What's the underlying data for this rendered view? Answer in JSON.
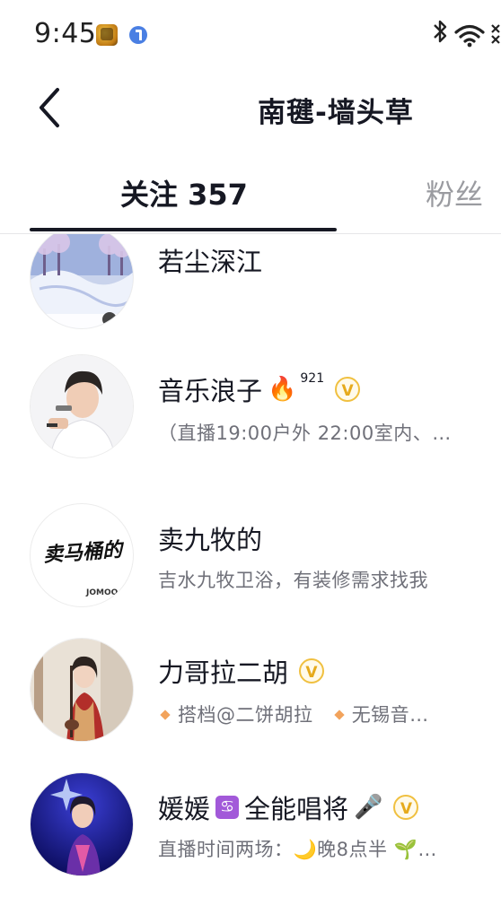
{
  "status_bar": {
    "time": "9:45"
  },
  "header": {
    "back_icon": "chevron-left-icon",
    "title": "南毽-墙头草"
  },
  "tabs": [
    {
      "label": "关注 357",
      "active": true
    },
    {
      "label": "粉丝",
      "active": false
    }
  ],
  "follow_list": [
    {
      "name": "若尘深江",
      "bio": ""
    },
    {
      "name": "音乐浪子",
      "emoji": "🔥",
      "sup": "921",
      "verified_mark": "V",
      "bio": "（直播19:00户外 22:00室内、…"
    },
    {
      "name": "卖九牧的",
      "bio": "吉水九牧卫浴，有装修需求找我",
      "avatar_text": "卖马桶的",
      "avatar_brand": "JOMOO"
    },
    {
      "name": "力哥拉二胡",
      "verified_mark": "V",
      "bio_parts": [
        "搭档@二饼胡拉",
        "无锡音…"
      ]
    },
    {
      "name_prefix": "媛媛",
      "zodiac": "♋",
      "name_suffix": "全能唱将",
      "emoji": "🎤",
      "verified_mark": "V",
      "bio": "直播时间两场：🌙晚8点半 🌱…"
    }
  ],
  "colors": {
    "text": "#161823",
    "secondary": "#6f7079",
    "badge": "#f0c040",
    "inactive_tab": "#9a9ba0"
  }
}
